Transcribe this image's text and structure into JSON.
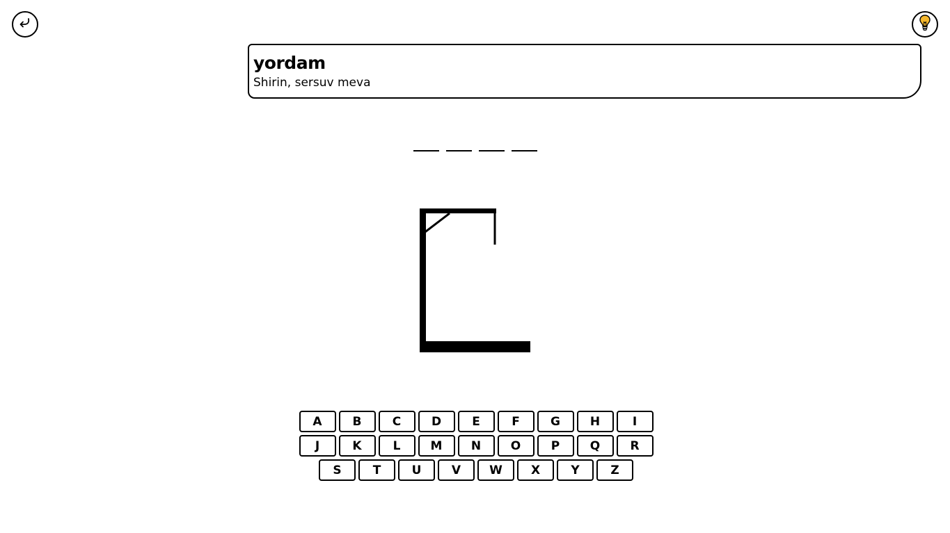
{
  "header": {
    "back_icon": "return-arrow-icon",
    "hint_icon": "lightbulb-icon",
    "hint_icon_color": "#f5b82e"
  },
  "hint": {
    "title": "yordam",
    "description": "Shirin, sersuv meva"
  },
  "word": {
    "letters": [
      "",
      "",
      "",
      ""
    ]
  },
  "keyboard": {
    "rows": [
      [
        "A",
        "B",
        "C",
        "D",
        "E",
        "F",
        "G",
        "H",
        "I"
      ],
      [
        "J",
        "K",
        "L",
        "M",
        "N",
        "O",
        "P",
        "Q",
        "R"
      ],
      [
        "S",
        "T",
        "U",
        "V",
        "W",
        "X",
        "Y",
        "Z"
      ]
    ]
  }
}
